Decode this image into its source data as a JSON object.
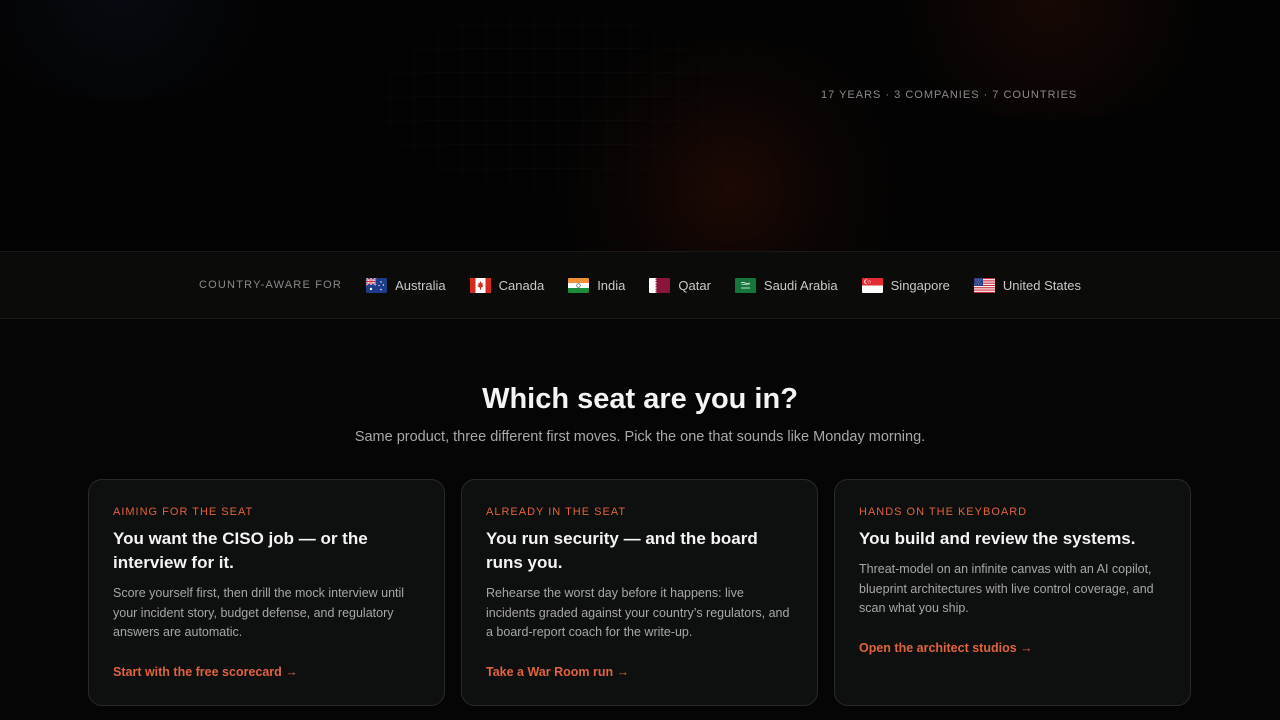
{
  "hero": {
    "stat": "17 YEARS · 3 COMPANIES · 7 COUNTRIES"
  },
  "country_strip": {
    "label": "COUNTRY-AWARE FOR",
    "countries": [
      {
        "name": "Australia",
        "flag": "australia-flag-icon"
      },
      {
        "name": "Canada",
        "flag": "canada-flag-icon"
      },
      {
        "name": "India",
        "flag": "india-flag-icon"
      },
      {
        "name": "Qatar",
        "flag": "qatar-flag-icon"
      },
      {
        "name": "Saudi Arabia",
        "flag": "saudi-arabia-flag-icon"
      },
      {
        "name": "Singapore",
        "flag": "singapore-flag-icon"
      },
      {
        "name": "United States",
        "flag": "united-states-flag-icon"
      }
    ]
  },
  "section": {
    "title": "Which seat are you in?",
    "subtitle": "Same product, three different first moves. Pick the one that sounds like Monday morning."
  },
  "cards": [
    {
      "eyebrow": "AIMING FOR THE SEAT",
      "title": "You want the CISO job — or the interview for it.",
      "body": "Score yourself first, then drill the mock interview until your incident story, budget defense, and regulatory answers are automatic.",
      "link": "Start with the free scorecard →"
    },
    {
      "eyebrow": "ALREADY IN THE SEAT",
      "title": "You run security — and the board runs you.",
      "body": "Rehearse the worst day before it happens: live incidents graded against your country’s regulators, and a board-report coach for the write-up.",
      "link": "Take a War Room run →"
    },
    {
      "eyebrow": "HANDS ON THE KEYBOARD",
      "title": "You build and review the systems.",
      "body": "Threat-model on an infinite canvas with an AI copilot, blueprint architectures with live control coverage, and scan what you ship.",
      "link": "Open the architect studios →"
    }
  ],
  "colors": {
    "accent": "#e0633e",
    "background": "#050505",
    "card_background": "#0e0f0f",
    "card_border": "#2a2a2a"
  }
}
